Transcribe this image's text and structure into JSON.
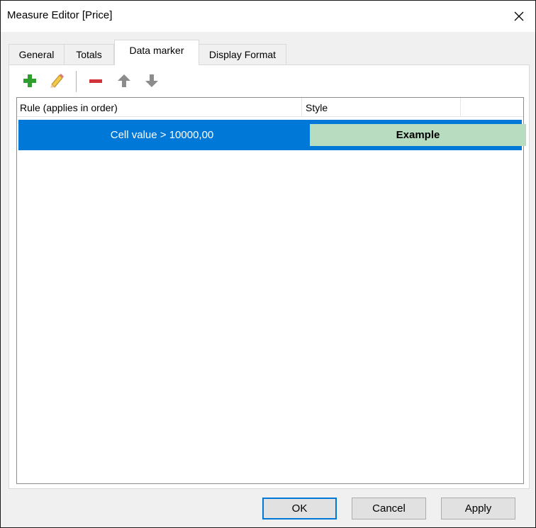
{
  "window": {
    "title": "Measure Editor [Price]"
  },
  "tabs": [
    {
      "label": "General"
    },
    {
      "label": "Totals"
    },
    {
      "label": "Data marker"
    },
    {
      "label": "Display Format"
    }
  ],
  "toolbar": {
    "icons": [
      "add-icon",
      "edit-pencil-icon",
      "remove-icon",
      "move-up-icon",
      "move-down-icon"
    ],
    "colors": {
      "add": "#2e9e2e",
      "remove": "#d0343a",
      "arrow": "#8c8c8c"
    }
  },
  "list": {
    "columns": [
      {
        "label": "Rule (applies in order)"
      },
      {
        "label": "Style"
      }
    ],
    "rows": [
      {
        "rule": "Cell value > 10000,00",
        "style_example": "Example",
        "selected": true,
        "style_bg": "#b8dcbf"
      }
    ]
  },
  "buttons": {
    "ok": "OK",
    "cancel": "Cancel",
    "apply": "Apply"
  },
  "colors": {
    "selection": "#0078d7"
  }
}
